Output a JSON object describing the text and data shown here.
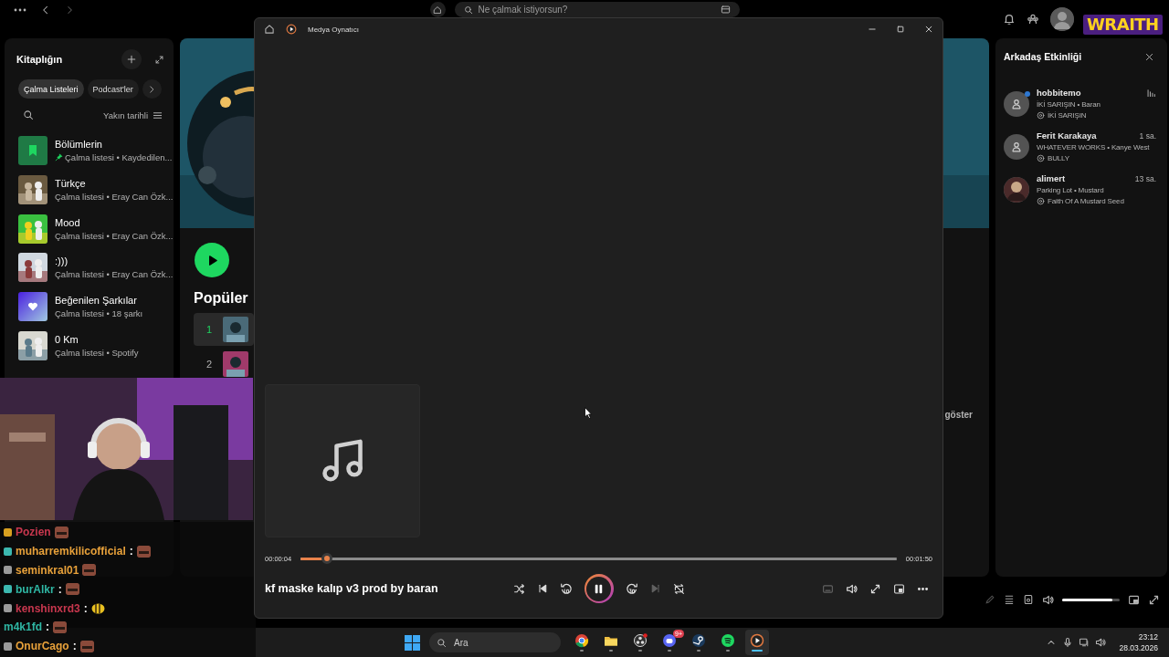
{
  "topbar": {
    "search_placeholder": "Ne çalmak istiyorsun?"
  },
  "overlay_logo": "WRAITH",
  "library": {
    "title": "Kitaplığın",
    "sort": "Yakın tarihli",
    "filters": [
      {
        "label": "Çalma Listeleri",
        "selected": true
      },
      {
        "label": "Podcast'ler",
        "selected": false
      }
    ],
    "items": [
      {
        "title": "Bölümlerin",
        "subtitle": "Çalma listesi • Kaydedilen...",
        "kind": "bookmark",
        "pinned": true
      },
      {
        "title": "Türkçe",
        "subtitle": "Çalma listesi • Eray Can Özk...",
        "kind": "picture",
        "pinned": false
      },
      {
        "title": "Mood",
        "subtitle": "Çalma listesi • Eray Can Özk...",
        "kind": "picture",
        "pinned": false
      },
      {
        "title": ":)))",
        "subtitle": "Çalma listesi • Eray Can Özk...",
        "kind": "picture",
        "pinned": false
      },
      {
        "title": "Beğenilen Şarkılar",
        "subtitle": "Çalma listesi • 18 şarkı",
        "kind": "liked",
        "pinned": false
      },
      {
        "title": "0 Km",
        "subtitle": "Çalma listesi • Spotify",
        "kind": "picture",
        "pinned": false
      }
    ]
  },
  "artist": {
    "section_title": "Popüler",
    "show_all": "göster",
    "tracks": [
      {
        "number": "1",
        "selected": true
      },
      {
        "number": "2",
        "selected": false
      }
    ]
  },
  "friends": {
    "title": "Arkadaş Etkinliği",
    "items": [
      {
        "name": "hobbitemo",
        "track": "İKİ SARIŞIN • Baran",
        "source": "İKİ SARIŞIN",
        "kind": "placeholder",
        "online": true,
        "listening": true
      },
      {
        "name": "Ferit Karakaya",
        "time": "1 sa.",
        "track": "WHATEVER WORKS • Kanye West",
        "source": "BULLY",
        "kind": "placeholder",
        "online": false,
        "listening": false
      },
      {
        "name": "alimert",
        "time": "13 sa.",
        "track": "Parking Lot • Mustard",
        "source": "Faith Of A Mustard Seed",
        "online": false,
        "listening": false
      }
    ]
  },
  "spotify_player": {
    "volume": {
      "level": 0.87
    }
  },
  "media_player": {
    "title": "Medya Oynatıcı",
    "elapsed": "00:00:04",
    "total": "00:01:50",
    "progress": {
      "level": 0.045
    },
    "track_title": "kf maske kalıp v3 prod by baran",
    "playing": true,
    "next_disabled": true,
    "captions_disabled": true
  },
  "chat": [
    {
      "user": "Pozien",
      "color": "#c8374e",
      "badge": {
        "color": "#d8a020"
      },
      "emote": {
        "kind": "face"
      }
    },
    {
      "user": "muharremkilicofficial",
      "separator": ":",
      "color": "#e8a13a",
      "badge": {
        "color": "#3cb8b0"
      },
      "emote": {
        "kind": "face"
      }
    },
    {
      "user": "seminkral01",
      "color": "#e8a13a",
      "badge": {
        "color": "#9a9a9a"
      },
      "emote": {
        "kind": "face"
      }
    },
    {
      "user": "burAlkr",
      "separator": ":",
      "color": "#2fb7a4",
      "badge": {
        "color": "#3cb8b0"
      },
      "emote": {
        "kind": "face"
      }
    },
    {
      "user": "kenshinxrd3",
      "separator": ":",
      "color": "#c8374e",
      "badge": {
        "color": "#9a9a9a"
      },
      "emote": {
        "kind": "bee"
      }
    },
    {
      "user": "m4k1fd",
      "separator": ":",
      "color": "#2fb7a4",
      "emote": {
        "kind": "face"
      }
    },
    {
      "user": "OnurCago",
      "separator": ":",
      "color": "#e8a13a",
      "badge": {
        "color": "#9a9a9a"
      },
      "emote": {
        "kind": "face"
      }
    }
  ],
  "taskbar": {
    "search_placeholder": "Ara",
    "time": "23:12",
    "date": "28.03.2026",
    "apps": [
      {
        "kind": "chrome",
        "active": false
      },
      {
        "kind": "folder",
        "active": false
      },
      {
        "kind": "obs",
        "active": false
      },
      {
        "kind": "discord",
        "active": false,
        "badge": "9+"
      },
      {
        "kind": "steam",
        "active": false
      },
      {
        "kind": "spotify",
        "active": false
      },
      {
        "kind": "media",
        "active": true
      }
    ]
  }
}
